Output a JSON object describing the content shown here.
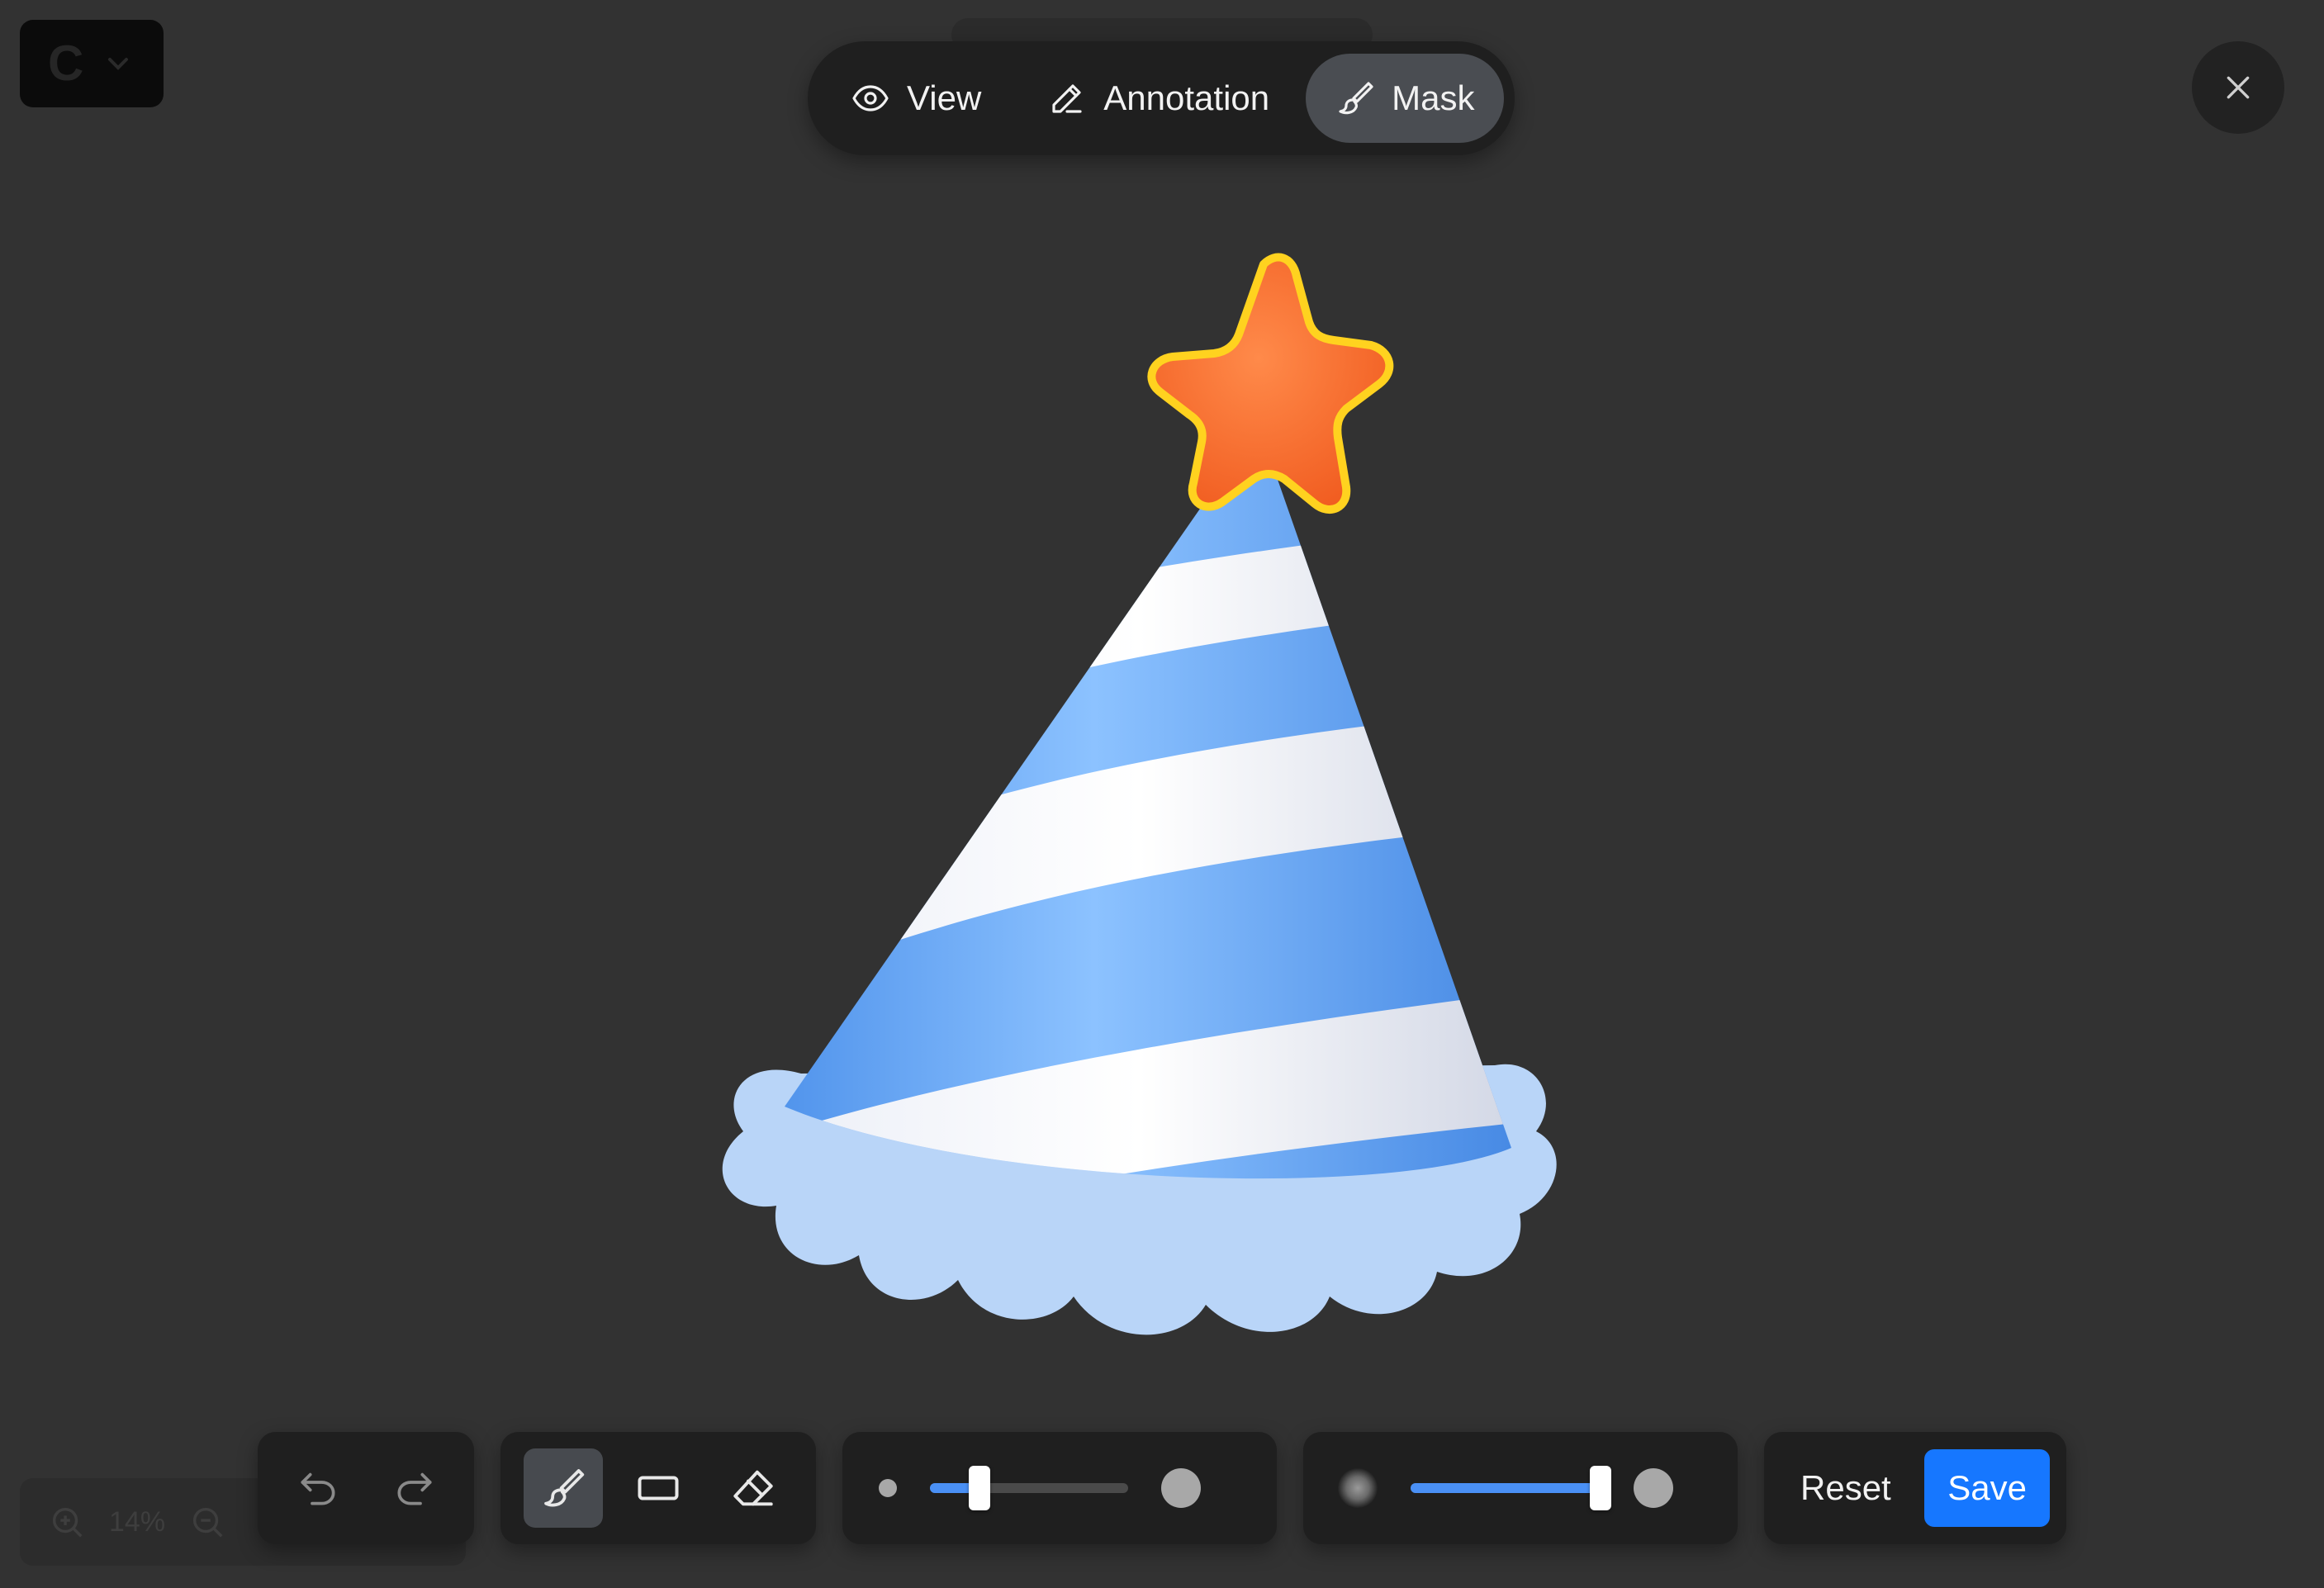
{
  "logo": {
    "letter": "C"
  },
  "modes": [
    {
      "label": "View",
      "icon": "eye-icon",
      "active": false
    },
    {
      "label": "Annotation",
      "icon": "pencil-icon",
      "active": false
    },
    {
      "label": "Mask",
      "icon": "brush-icon",
      "active": true
    }
  ],
  "zoom": {
    "level": "14%"
  },
  "tools": {
    "active": "brush"
  },
  "brush_size": {
    "value": 0.25
  },
  "brush_softness": {
    "value": 1.0
  },
  "actions": {
    "reset_label": "Reset",
    "save_label": "Save"
  },
  "colors": {
    "accent": "#1677ff",
    "slider": "#4a90f5",
    "background": "#323232",
    "toolbar": "#1f1f1f"
  }
}
